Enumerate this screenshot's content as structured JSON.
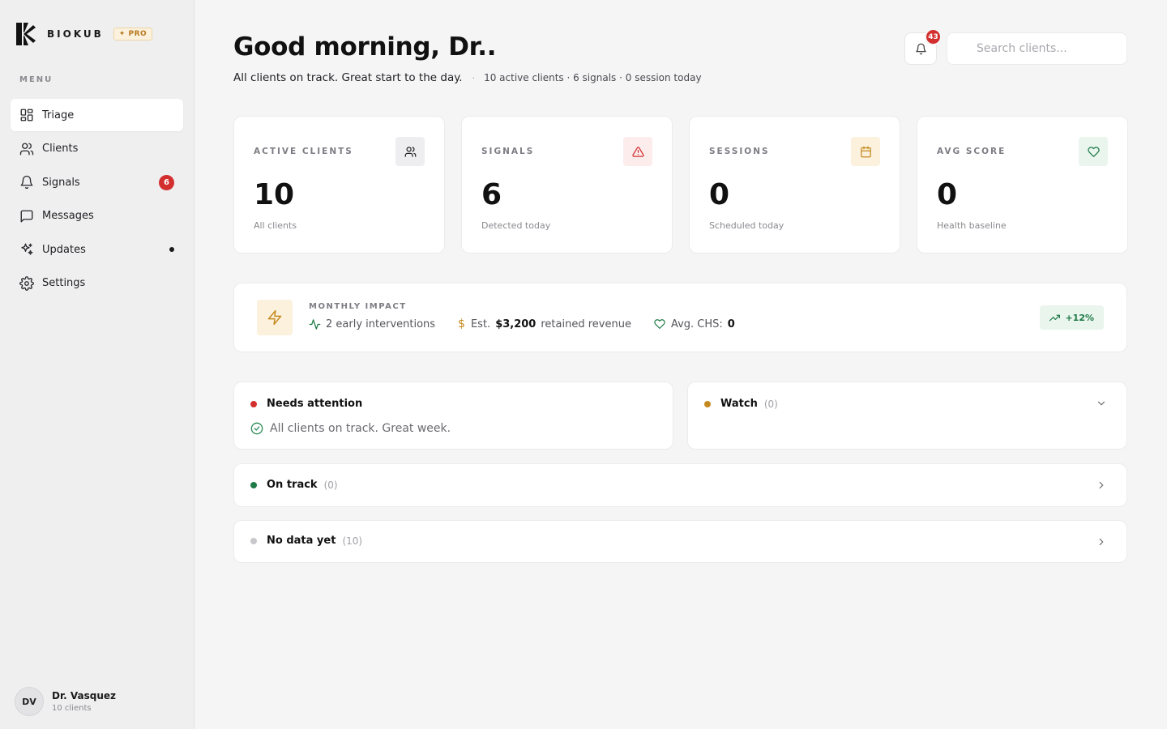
{
  "colors": {
    "accent_red": "#d32f2f",
    "accent_amber": "#c58a1f",
    "accent_green": "#1e7a46",
    "muted_gray": "#c8c8cc"
  },
  "brand": {
    "name": "BIOKUB",
    "badge": "✦ PRO",
    "logo_icon": "biokub-logo-icon"
  },
  "sidebar": {
    "menu_title": "MENU",
    "items": [
      {
        "label": "Triage",
        "icon": "grid-icon",
        "active": true
      },
      {
        "label": "Clients",
        "icon": "users-icon"
      },
      {
        "label": "Signals",
        "icon": "bell-icon",
        "count": "6"
      },
      {
        "label": "Messages",
        "icon": "message-square-icon"
      },
      {
        "label": "Updates",
        "icon": "sparkles-icon",
        "dot": true
      },
      {
        "label": "Settings",
        "icon": "gear-icon"
      }
    ],
    "user": {
      "initials": "DV",
      "name": "Dr. Vasquez",
      "sub": "10 clients"
    }
  },
  "header": {
    "greeting": "Good morning, Dr..",
    "subtitle": "All clients on track. Great start to the day.",
    "separator": "·",
    "stats": "10 active clients · 6 signals · 0 session today",
    "notifications": "43",
    "search_placeholder": "Search clients..."
  },
  "cards": [
    {
      "label": "ACTIVE CLIENTS",
      "value": "10",
      "note": "All clients",
      "icon": "users-icon"
    },
    {
      "label": "SIGNALS",
      "value": "6",
      "note": "Detected today",
      "icon": "alert-triangle-icon"
    },
    {
      "label": "SESSIONS",
      "value": "0",
      "note": "Scheduled today",
      "icon": "calendar-icon"
    },
    {
      "label": "AVG SCORE",
      "value": "0",
      "note": "Health baseline",
      "icon": "heart-icon"
    }
  ],
  "impact": {
    "title": "MONTHLY IMPACT",
    "interventions": "2 early interventions",
    "est_prefix": "Est.",
    "revenue": "$3,200",
    "revenue_suffix": "retained revenue",
    "chs_label": "Avg. CHS:",
    "chs_value": "0",
    "trend": "+12%"
  },
  "groups": {
    "needs_attention": {
      "name": "Needs attention",
      "empty_text": "All clients on track. Great week."
    },
    "watch": {
      "name": "Watch",
      "count": "(0)"
    },
    "on_track": {
      "name": "On track",
      "count": "(0)"
    },
    "no_data": {
      "name": "No data yet",
      "count": "(10)"
    }
  }
}
